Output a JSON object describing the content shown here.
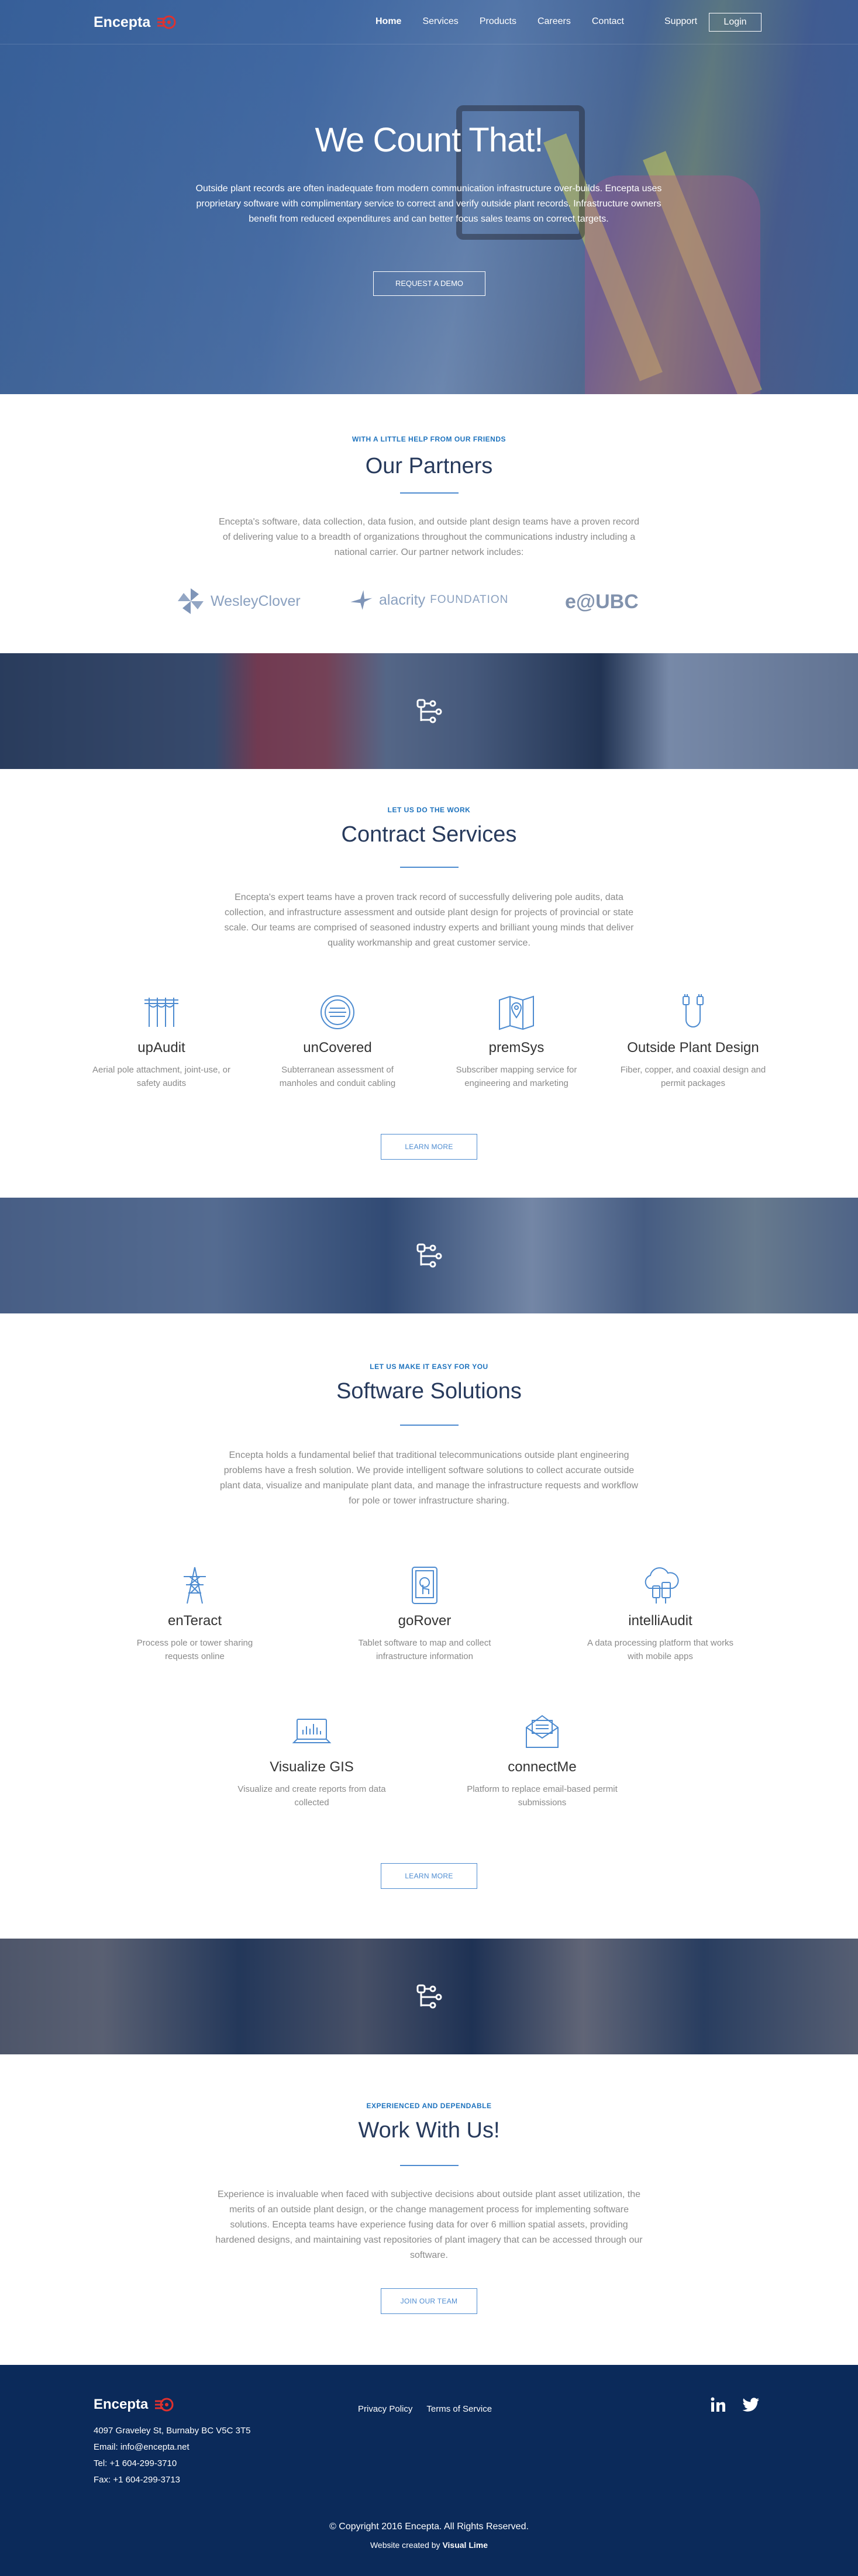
{
  "brand": {
    "name": "Encepta",
    "accent": "#e0312e",
    "primary": "#1e73be",
    "footer_bg": "#0b2a5a"
  },
  "nav": {
    "links": [
      "Home",
      "Services",
      "Products",
      "Careers",
      "Contact"
    ],
    "active": "Home",
    "support": "Support",
    "login": "Login"
  },
  "hero": {
    "title": "We Count That!",
    "text": "Outside plant records are often inadequate from modern communication infrastructure over-builds. Encepta uses proprietary software with complimentary service to correct and verify outside plant records. Infrastructure owners benefit from reduced expenditures and can better focus sales teams on correct targets.",
    "button": "REQUEST A DEMO"
  },
  "partners": {
    "kicker": "WITH A LITTLE HELP FROM OUR FRIENDS",
    "title": "Our Partners",
    "text": "Encepta's software, data collection, data fusion, and outside plant design teams have a proven record of delivering value to a breadth of organizations throughout the communications industry including a national carrier. Our partner network includes:",
    "logos": [
      {
        "name": "WesleyClover",
        "icon": "pinwheel-icon"
      },
      {
        "name": "alacrity",
        "suffix": "FOUNDATION",
        "icon": "bird-icon"
      },
      {
        "name": "e@UBC",
        "icon": "none"
      }
    ]
  },
  "services": {
    "kicker": "LET US DO THE WORK",
    "title": "Contract Services",
    "text": "Encepta's expert teams have a proven track record of successfully delivering pole audits, data collection, and infrastructure assessment and outside plant design for projects of provincial or state scale. Our teams are comprised of seasoned industry experts and brilliant young minds that deliver quality workmanship and great customer service.",
    "items": [
      {
        "title": "upAudit",
        "text": "Aerial pole attachment, joint-use, or safety audits",
        "icon": "utility-poles-icon"
      },
      {
        "title": "unCovered",
        "text": "Subterranean assessment of manholes and conduit cabling",
        "icon": "manhole-icon"
      },
      {
        "title": "premSys",
        "text": "Subscriber mapping service for engineering and marketing",
        "icon": "map-pin-icon"
      },
      {
        "title": "Outside Plant Design",
        "text": "Fiber, copper, and coaxial design and permit packages",
        "icon": "cable-icon"
      }
    ],
    "button": "LEARN MORE"
  },
  "software": {
    "kicker": "LET US MAKE IT EASY FOR YOU",
    "title": "Software Solutions",
    "text": "Encepta holds a fundamental belief that traditional telecommunications outside plant engineering problems have a fresh solution. We provide intelligent software solutions to collect accurate outside plant data, visualize and manipulate plant data, and manage the infrastructure requests and workflow for pole or tower infrastructure sharing.",
    "items": [
      {
        "title": "enTeract",
        "text": "Process pole or tower sharing requests online",
        "icon": "transmission-tower-icon"
      },
      {
        "title": "goRover",
        "text": "Tablet software to map and collect infrastructure information",
        "icon": "tablet-touch-icon"
      },
      {
        "title": "intelliAudit",
        "text": "A data processing platform that works with mobile apps",
        "icon": "cloud-devices-icon"
      },
      {
        "title": "Visualize GIS",
        "text": "Visualize and create reports from data collected",
        "icon": "laptop-chart-icon"
      },
      {
        "title": "connectMe",
        "text": "Platform to replace email-based permit submissions",
        "icon": "envelope-icon"
      }
    ],
    "button": "LEARN MORE"
  },
  "work": {
    "kicker": "EXPERIENCED AND DEPENDABLE",
    "title": "Work With Us!",
    "text": "Experience is invaluable when faced with subjective decisions about outside plant asset utilization, the merits of an outside plant design, or the change management process for implementing software solutions. Encepta teams have experience fusing data for over 6 million spatial assets, providing hardened designs, and maintaining vast repositories of plant imagery that can be accessed through our software.",
    "button": "JOIN OUR TEAM"
  },
  "banner_icon": "network-node-icon",
  "footer": {
    "address": "4097 Graveley St, Burnaby BC V5C 3T5",
    "email": "Email: info@encepta.net",
    "tel": "Tel: +1 604-299-3710",
    "fax": "Fax: +1 604-299-3713",
    "links": [
      "Privacy Policy",
      "Terms of Service"
    ],
    "social": [
      "linkedin-icon",
      "twitter-icon"
    ],
    "copyright": "© Copyright 2016 Encepta. All Rights Reserved.",
    "credit_prefix": "Website created by",
    "credit_name": "Visual Lime"
  }
}
